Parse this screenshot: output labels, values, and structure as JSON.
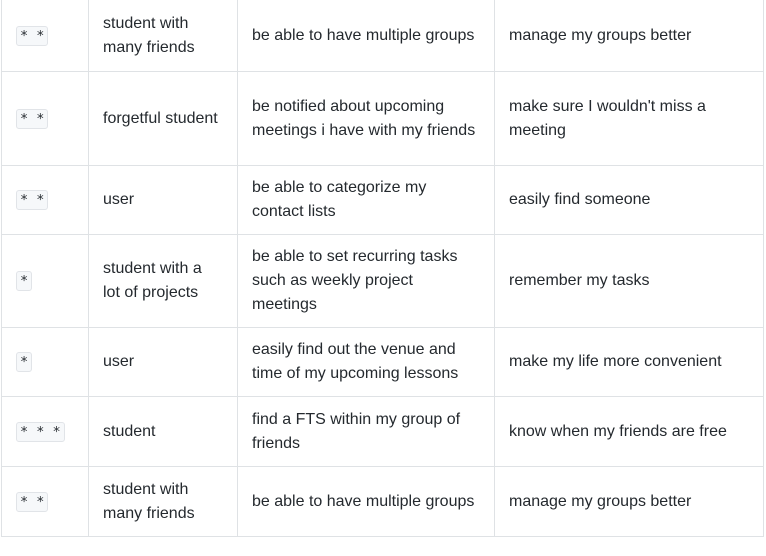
{
  "rows": [
    {
      "priority": "* *",
      "as_a": "student with many friends",
      "i_want_to": "be able to have multiple groups",
      "so_that": "manage my groups better"
    },
    {
      "priority": "* *",
      "as_a": "forgetful student",
      "i_want_to": "be notified about upcoming meetings i have with my friends",
      "so_that": "make sure I wouldn't miss a meeting"
    },
    {
      "priority": "* *",
      "as_a": "user",
      "i_want_to": "be able to categorize my contact lists",
      "so_that": "easily find someone"
    },
    {
      "priority": "*",
      "as_a": "student with a lot of projects",
      "i_want_to": "be able to set recurring tasks such as weekly project meetings",
      "so_that": "remember my tasks"
    },
    {
      "priority": "*",
      "as_a": "user",
      "i_want_to": "easily find out the venue and time of my upcoming lessons",
      "so_that": "make my life more convenient"
    },
    {
      "priority": "* * *",
      "as_a": "student",
      "i_want_to": "find a FTS within my group of friends",
      "so_that": "know when my friends are free"
    },
    {
      "priority": "* *",
      "as_a": "student with many friends",
      "i_want_to": "be able to have multiple groups",
      "so_that": "manage my groups better"
    }
  ]
}
